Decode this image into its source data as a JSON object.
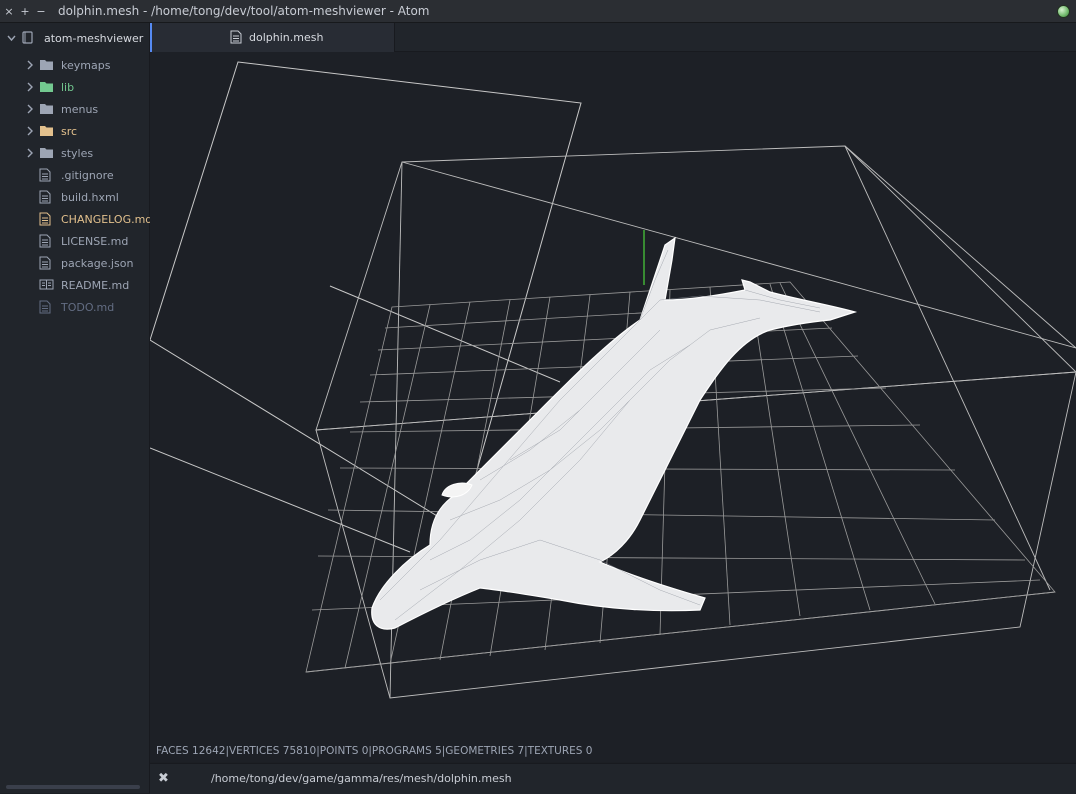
{
  "window": {
    "title": "dolphin.mesh - /home/tong/dev/tool/atom-meshviewer - Atom",
    "buttons": [
      "×",
      "+",
      "−"
    ]
  },
  "tree": {
    "root": "atom-meshviewer",
    "items": [
      {
        "label": "keymaps",
        "type": "folder",
        "status": "default"
      },
      {
        "label": "lib",
        "type": "folder",
        "status": "added"
      },
      {
        "label": "menus",
        "type": "folder",
        "status": "default"
      },
      {
        "label": "src",
        "type": "folder",
        "status": "modified"
      },
      {
        "label": "styles",
        "type": "folder",
        "status": "default"
      },
      {
        "label": ".gitignore",
        "type": "file",
        "status": "default"
      },
      {
        "label": "build.hxml",
        "type": "file",
        "status": "default"
      },
      {
        "label": "CHANGELOG.md",
        "type": "file",
        "status": "modified"
      },
      {
        "label": "LICENSE.md",
        "type": "file",
        "status": "default"
      },
      {
        "label": "package.json",
        "type": "file",
        "status": "default"
      },
      {
        "label": "README.md",
        "type": "book",
        "status": "default"
      },
      {
        "label": "TODO.md",
        "type": "file",
        "status": "ignored"
      }
    ]
  },
  "tabs": [
    {
      "label": "dolphin.mesh",
      "active": true
    }
  ],
  "viewer": {
    "stats": "FACES 12642|VERTICES 75810|POINTS 0|PROGRAMS 5|GEOMETRIES 7|TEXTURES 0"
  },
  "status_bar": {
    "path": "/home/tong/dev/game/gamma/res/mesh/dolphin.mesh"
  },
  "colors": {
    "accent": "#568af2",
    "added": "#73c990",
    "modified": "#e2c08d",
    "ignored": "#636d83"
  }
}
